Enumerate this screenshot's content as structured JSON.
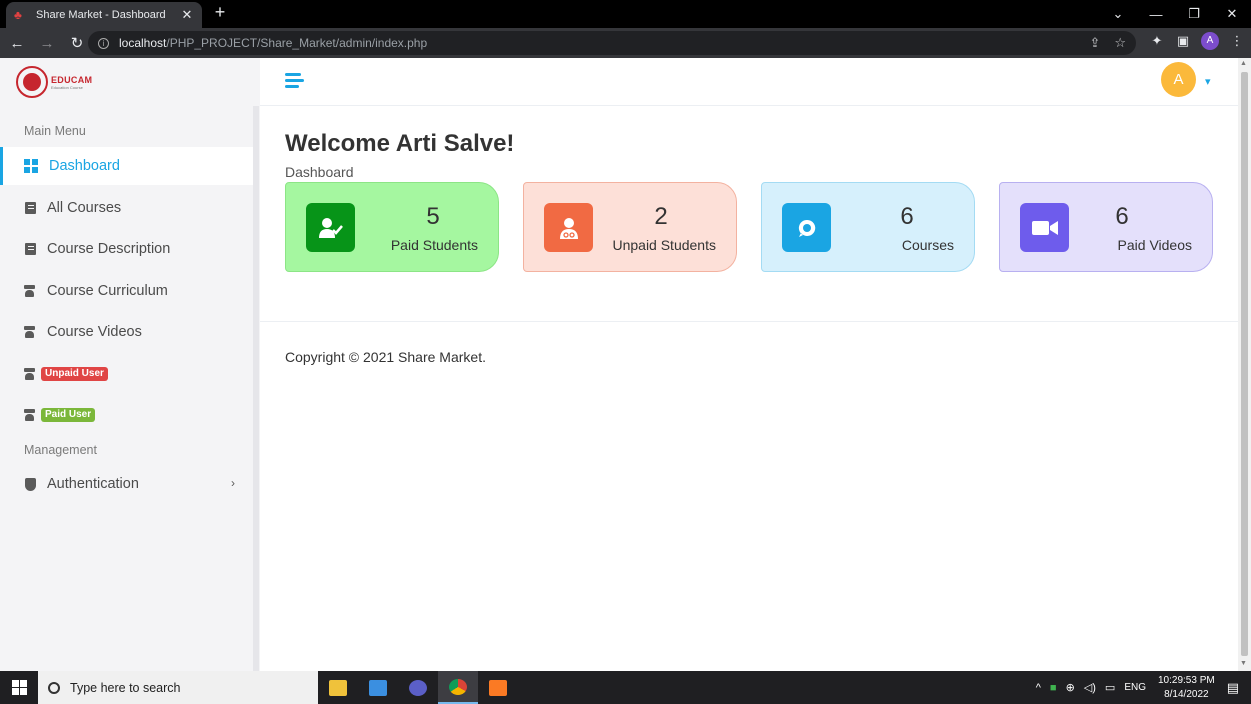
{
  "browser": {
    "tab_title": "Share Market - Dashboard",
    "tab_close": "✕",
    "new_tab": "+",
    "url_host": "localhost",
    "url_path": "/PHP_PROJECT/Share_Market/admin/index.php",
    "profile_initial": "A"
  },
  "logo": {
    "name": "EDUCAM",
    "subtitle": "Education Course"
  },
  "sidebar": {
    "main_menu_title": "Main Menu",
    "management_title": "Management",
    "items": [
      {
        "label": "Dashboard",
        "icon": "grid-icon",
        "active": true
      },
      {
        "label": "All Courses",
        "icon": "book-icon"
      },
      {
        "label": "Course Description",
        "icon": "book-icon"
      },
      {
        "label": "Course Curriculum",
        "icon": "teacher-icon"
      },
      {
        "label": "Course Videos",
        "icon": "teacher-icon"
      },
      {
        "label": "Unpaid User",
        "icon": "teacher-icon",
        "badge_color": "#e04545"
      },
      {
        "label": "Paid User",
        "icon": "teacher-icon",
        "badge_color": "#7bb73a"
      },
      {
        "label": "Authentication",
        "icon": "shield-icon"
      }
    ]
  },
  "header": {
    "avatar_initial": "A"
  },
  "main": {
    "welcome": "Welcome Arti Salve!",
    "breadcrumb": "Dashboard",
    "cards": [
      {
        "value": "5",
        "label": "Paid Students",
        "icon": "user-check-icon",
        "bg": "#a5f7a0",
        "border": "#8ce586",
        "icon_bg": "#079418"
      },
      {
        "value": "2",
        "label": "Unpaid Students",
        "icon": "user-doctor-icon",
        "bg": "#fde0d8",
        "border": "#f3b2a0",
        "icon_bg": "#f16a43"
      },
      {
        "value": "6",
        "label": "Courses",
        "icon": "chat-icon",
        "bg": "#d6f0fc",
        "border": "#a4dbf3",
        "icon_bg": "#1aa5e3"
      },
      {
        "value": "6",
        "label": "Paid Videos",
        "icon": "video-icon",
        "bg": "#e4e0fb",
        "border": "#b8b0f0",
        "icon_bg": "#6e5cec"
      }
    ],
    "copyright": "Copyright © 2021 Share Market."
  },
  "taskbar": {
    "search_placeholder": "Type here to search",
    "language": "ENG",
    "time": "10:29:53 PM",
    "date": "8/14/2022"
  }
}
